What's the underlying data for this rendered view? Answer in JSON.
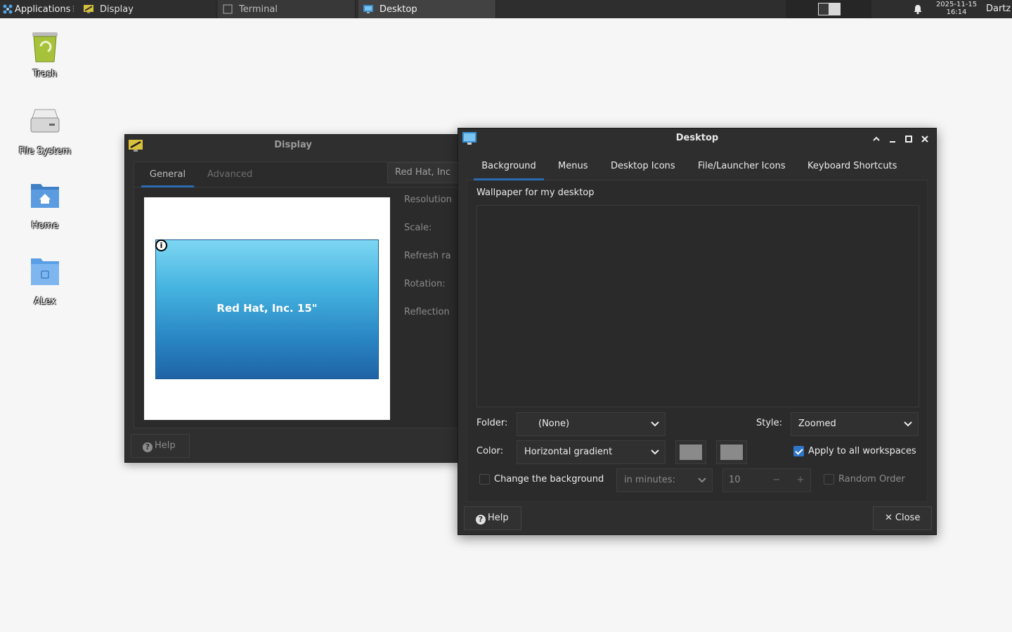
{
  "panel": {
    "applications_label": "Applications",
    "tasks": [
      {
        "label": "Display"
      },
      {
        "label": "Terminal"
      },
      {
        "label": "Desktop"
      }
    ],
    "clock_date": "2025-11-15",
    "clock_time": "16:14",
    "user": "Dartz"
  },
  "desktop_icons": [
    {
      "label": "Trash"
    },
    {
      "label": "File System"
    },
    {
      "label": "Home"
    },
    {
      "label": "ALex"
    }
  ],
  "display_window": {
    "title": "Display",
    "tabs": [
      "General",
      "Advanced"
    ],
    "monitor_label": "Red Hat, Inc. 15\"",
    "info_symbol": "i",
    "output_combo": "Red Hat, Inc",
    "fields": [
      "Resolution",
      "Scale:",
      "Refresh ra",
      "Rotation:",
      "Reflection"
    ],
    "help_label": "Help"
  },
  "desktop_window": {
    "title": "Desktop",
    "tabs": [
      "Background",
      "Menus",
      "Desktop Icons",
      "File/Launcher Icons",
      "Keyboard Shortcuts"
    ],
    "wallpaper_label": "Wallpaper for my desktop",
    "folder_label": "Folder:",
    "folder_value": "(None)",
    "style_label": "Style:",
    "style_value": "Zoomed",
    "color_label": "Color:",
    "color_value": "Horizontal gradient",
    "color1": "#8a8a8a",
    "color2": "#8a8a8a",
    "apply_all_label": "Apply to all workspaces",
    "apply_all_checked": true,
    "change_bg_label": "Change the background",
    "change_bg_checked": false,
    "interval_unit": "in minutes:",
    "interval_value": "10",
    "random_order_label": "Random Order",
    "random_order_checked": false,
    "help_label": "Help",
    "close_label": "Close"
  },
  "colors": {
    "accent": "#2b6cb0",
    "window_bg": "#2e2e2e",
    "desktop_bg": "#f6f6f6"
  }
}
